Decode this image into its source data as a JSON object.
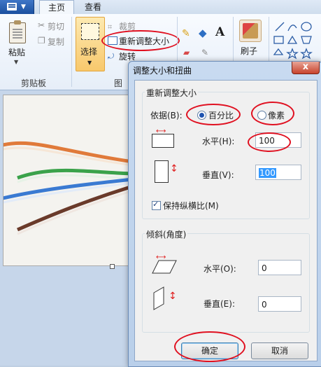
{
  "ribbon": {
    "tabs": [
      {
        "label": "主页"
      },
      {
        "label": "查看"
      }
    ],
    "clipboard": {
      "paste_label": "粘贴",
      "cut_label": "剪切",
      "copy_label": "复制",
      "group_label": "剪贴板"
    },
    "image": {
      "select_label": "选择",
      "crop_label": "裁剪",
      "resize_label": "重新调整大小",
      "rotate_label": "旋转",
      "group_label_partial": "图"
    },
    "tools": {
      "text_tool_label": "A",
      "brushes_label": "刷子"
    }
  },
  "dialog": {
    "title": "调整大小和扭曲",
    "close_label": "x",
    "resize_group_label": "重新调整大小",
    "by_label": "依据(B):",
    "percent_label": "百分比",
    "pixels_label": "像素",
    "selected_mode": "百分比",
    "horizontal_label": "水平(H):",
    "horizontal_value": "100",
    "vertical_label": "垂直(V):",
    "vertical_value": "100",
    "keep_ratio_label": "保持纵横比(M)",
    "keep_ratio_checked": true,
    "skew_group_label": "倾斜(角度)",
    "skew_horizontal_label": "水平(O):",
    "skew_horizontal_value": "0",
    "skew_vertical_label": "垂直(E):",
    "skew_vertical_value": "0",
    "ok_label": "确定",
    "cancel_label": "取消"
  },
  "colors": {
    "highlight_circle": "#e01020",
    "ribbon_bg": "#e6eef8",
    "app_button": "#2a5ea9"
  }
}
